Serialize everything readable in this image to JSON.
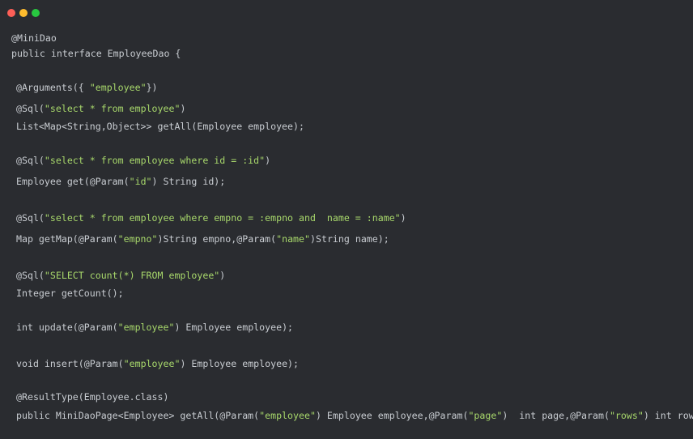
{
  "colors": {
    "background": "#2a2c30",
    "text": "#c8ccd1",
    "string": "#a8d86b",
    "dot_close": "#fd5f57",
    "dot_minimize": "#febc2e",
    "dot_maximize": "#28c840"
  },
  "code_lines": [
    [
      {
        "t": "@MiniDao"
      }
    ],
    [
      {
        "t": "public interface EmployeeDao {"
      }
    ],
    [
      {
        "t": "@Arguments({ "
      },
      {
        "t": "\"employee\"",
        "s": true
      },
      {
        "t": "})"
      }
    ],
    [
      {
        "t": "@Sql("
      },
      {
        "t": "\"select * from employee\"",
        "s": true
      },
      {
        "t": ")"
      }
    ],
    [
      {
        "t": "List<Map<String,Object>> getAll(Employee employee);"
      }
    ],
    [
      {
        "t": "@Sql("
      },
      {
        "t": "\"select * from employee where id = :id\"",
        "s": true
      },
      {
        "t": ")"
      }
    ],
    [
      {
        "t": "Employee get(@Param("
      },
      {
        "t": "\"id\"",
        "s": true
      },
      {
        "t": ") String id);"
      }
    ],
    [
      {
        "t": "@Sql("
      },
      {
        "t": "\"select * from employee where empno = :empno and  name = :name\"",
        "s": true
      },
      {
        "t": ")"
      }
    ],
    [
      {
        "t": "Map getMap(@Param("
      },
      {
        "t": "\"empno\"",
        "s": true
      },
      {
        "t": ")String empno,@Param("
      },
      {
        "t": "\"name\"",
        "s": true
      },
      {
        "t": ")String name);"
      }
    ],
    [
      {
        "t": "@Sql("
      },
      {
        "t": "\"SELECT count(*) FROM employee\"",
        "s": true
      },
      {
        "t": ")"
      }
    ],
    [
      {
        "t": "Integer getCount();"
      }
    ],
    [
      {
        "t": "int update(@Param("
      },
      {
        "t": "\"employee\"",
        "s": true
      },
      {
        "t": ") Employee employee);"
      }
    ],
    [
      {
        "t": "void insert(@Param("
      },
      {
        "t": "\"employee\"",
        "s": true
      },
      {
        "t": ") Employee employee);"
      }
    ],
    [
      {
        "t": "@ResultType(Employee.class)"
      }
    ],
    [
      {
        "t": "public MiniDaoPage<Employee> getAll(@Param("
      },
      {
        "t": "\"employee\"",
        "s": true
      },
      {
        "t": ") Employee employee,@Param("
      },
      {
        "t": "\"page\"",
        "s": true
      },
      {
        "t": ")  int page,@Param("
      },
      {
        "t": "\"rows\"",
        "s": true
      },
      {
        "t": ") int rows);"
      }
    ]
  ]
}
